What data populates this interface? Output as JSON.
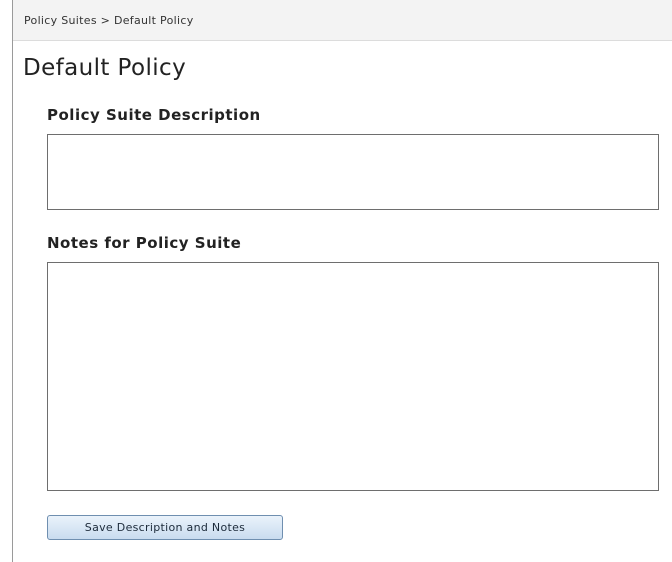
{
  "breadcrumb": {
    "text": "Policy Suites > Default Policy"
  },
  "page": {
    "title": "Default Policy"
  },
  "description": {
    "label": "Policy Suite Description",
    "value": ""
  },
  "notes": {
    "label": "Notes for Policy Suite",
    "value": ""
  },
  "actions": {
    "save_label": "Save Description and Notes"
  },
  "colors": {
    "breadcrumb_background": "#f3f3f3",
    "button_gradient_top": "#eaf3fb",
    "button_gradient_bottom": "#c9dcef",
    "button_border": "#6f8fb0",
    "field_border": "#6e6e6e"
  }
}
